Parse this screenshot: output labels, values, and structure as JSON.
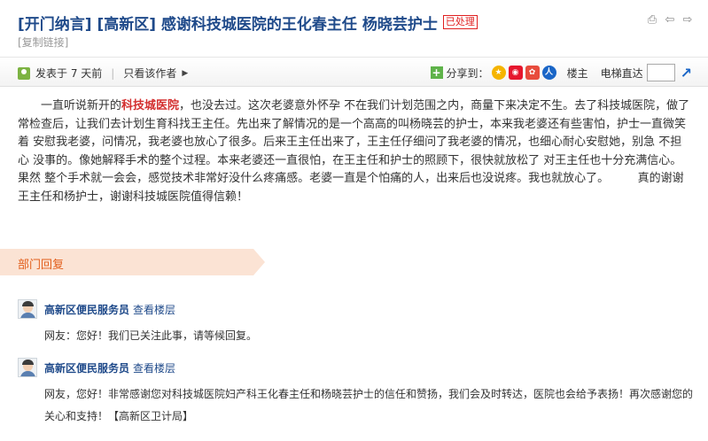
{
  "header": {
    "title": "[开门纳言] [高新区] 感谢科技城医院的王化春主任 杨晓芸护士",
    "status_badge": "已处理",
    "copy_link": "[复制链接]"
  },
  "meta": {
    "posted": "发表于 7 天前",
    "only_author": "只看该作者",
    "share_label": "分享到：",
    "floor_label": "楼主",
    "elevator_label": "电梯直达"
  },
  "article": {
    "intro": "一直听说新开的",
    "hospital_highlight": "科技城医院",
    "body": "，也没去过。这次老婆意外怀孕 不在我们计划范围之内，商量下来决定不生。去了科技城医院，做了常检查后，让我们去计划生育科找王主任。先出来了解情况的是一个高高的叫杨晓芸的护士，本来我老婆还有些害怕，护士一直微笑着 安慰我老婆，问情况，我老婆也放心了很多。后来王主任出来了，王主任仔细问了我老婆的情况，也细心耐心安慰她，别急 不担心 没事的。像她解释手术的整个过程。本来老婆还一直很怕，在王主任和护士的照顾下，很快就放松了 对王主任也十分充满信心。果然 整个手术就一会会，感觉技术非常好没什么疼痛感。老婆一直是个怕痛的人，出来后也没说疼。我也就放心了。　　　真的谢谢王主任和杨护士，谢谢科技城医院值得信赖！"
  },
  "department": {
    "label": "部门回复"
  },
  "replies": [
    {
      "author": "高新区便民服务员",
      "view_floor": "查看楼层",
      "text": "网友：您好！我们已关注此事，请等候回复。"
    },
    {
      "author": "高新区便民服务员",
      "view_floor": "查看楼层",
      "text": "网友，您好！非常感谢您对科技城医院妇产科王化春主任和杨晓芸护士的信任和赞扬，我们会及时转达，医院也会给予表扬！再次感谢您的关心和支持！【高新区卫计局】"
    }
  ],
  "icons": {
    "print": "print-icon",
    "prev": "prev-arrow-icon",
    "next": "next-arrow-icon",
    "share_plus": "share-plus-icon",
    "qzone": "qzone-icon",
    "weibo": "sina-weibo-icon",
    "tweibo": "tencent-weibo-icon",
    "renren": "renren-icon",
    "go": "go-floor-icon"
  },
  "colors": {
    "title_blue": "#1f4a8a",
    "highlight_red": "#d32f2f",
    "badge_red": "#e02020",
    "dept_bg": "#fbe3d4",
    "dept_text": "#e25f1c"
  }
}
